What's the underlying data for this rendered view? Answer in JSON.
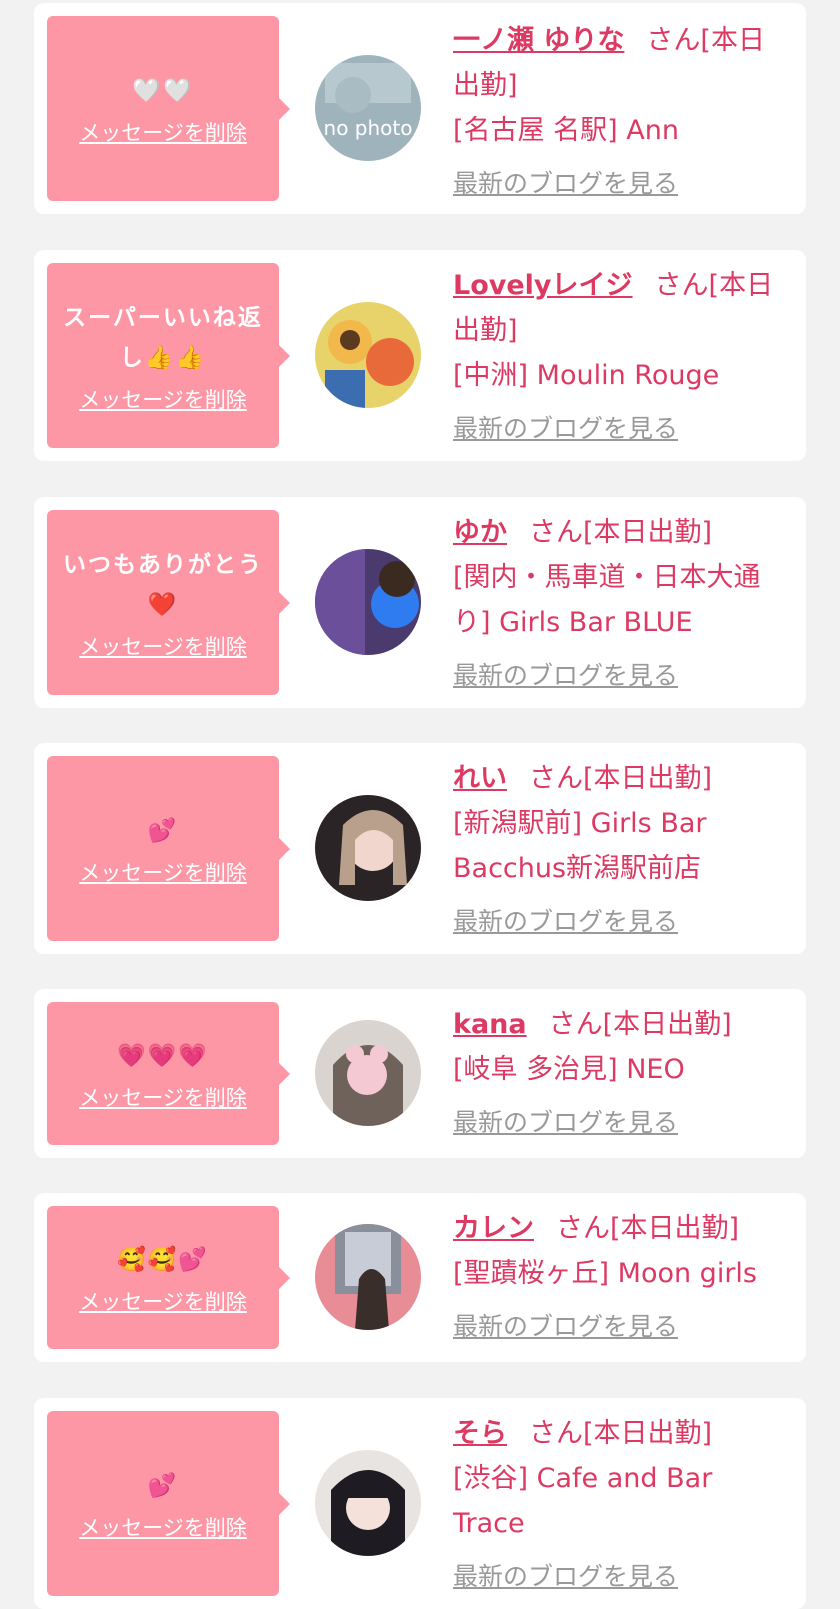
{
  "delete_label": "メッセージを削除",
  "blog_label": "最新のブログを見る",
  "san_label": "さん[本日出勤]",
  "colors": {
    "background": "#f2f2f2",
    "bubble": "#fe97a5",
    "accent": "#dc3963",
    "muted": "#999999"
  },
  "items": [
    {
      "message": "🤍🤍",
      "name": "一ノ瀬 ゆりな",
      "shop": "[名古屋 名駅] Ann",
      "avatar_text": "no photo"
    },
    {
      "message": "スーパーいいね返し👍👍",
      "name": "Lovelyレイジ",
      "shop": "[中洲] Moulin Rouge"
    },
    {
      "message": "いつもありがとう❤️",
      "name": "ゆか",
      "shop": "[関内・馬車道・日本大通り] Girls Bar BLUE"
    },
    {
      "message": "💕",
      "name": "れい",
      "shop": "[新潟駅前] Girls Bar Bacchus新潟駅前店"
    },
    {
      "message": "💗💗💗",
      "name": "kana",
      "shop": "[岐阜 多治見] NEO"
    },
    {
      "message": "🥰🥰💕",
      "name": "カレン",
      "shop": "[聖蹟桜ヶ丘] Moon girls"
    },
    {
      "message": "💕",
      "name": "そら",
      "shop": "[渋谷] Cafe and Bar Trace"
    }
  ]
}
